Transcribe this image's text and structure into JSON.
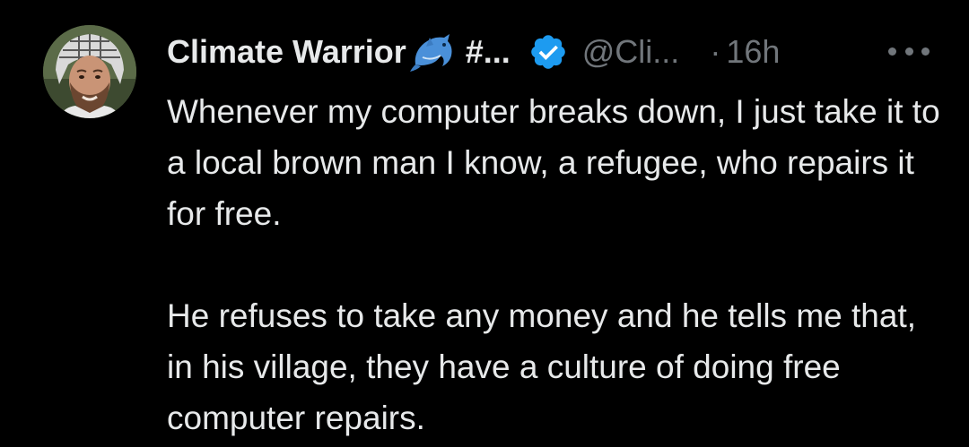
{
  "tweet": {
    "author": {
      "display_name": "Climate Warrior",
      "name_emoji": "dolphin-icon",
      "truncated_suffix": "#...",
      "verified": true,
      "handle": "@Cli...",
      "separator": "·",
      "timestamp": "16h"
    },
    "more_menu": "more-options-icon",
    "paragraphs": [
      "Whenever my computer breaks down, I just take it to a local brown man I know, a refugee, who repairs it for free.",
      "He refuses to take any money and he tells me that, in his village, they have a culture of doing free computer repairs."
    ],
    "colors": {
      "background": "#000000",
      "text_primary": "#e7e9ea",
      "text_secondary": "#71767b",
      "verified_badge": "#1d9bf0",
      "dolphin": "#4a90d9"
    }
  }
}
